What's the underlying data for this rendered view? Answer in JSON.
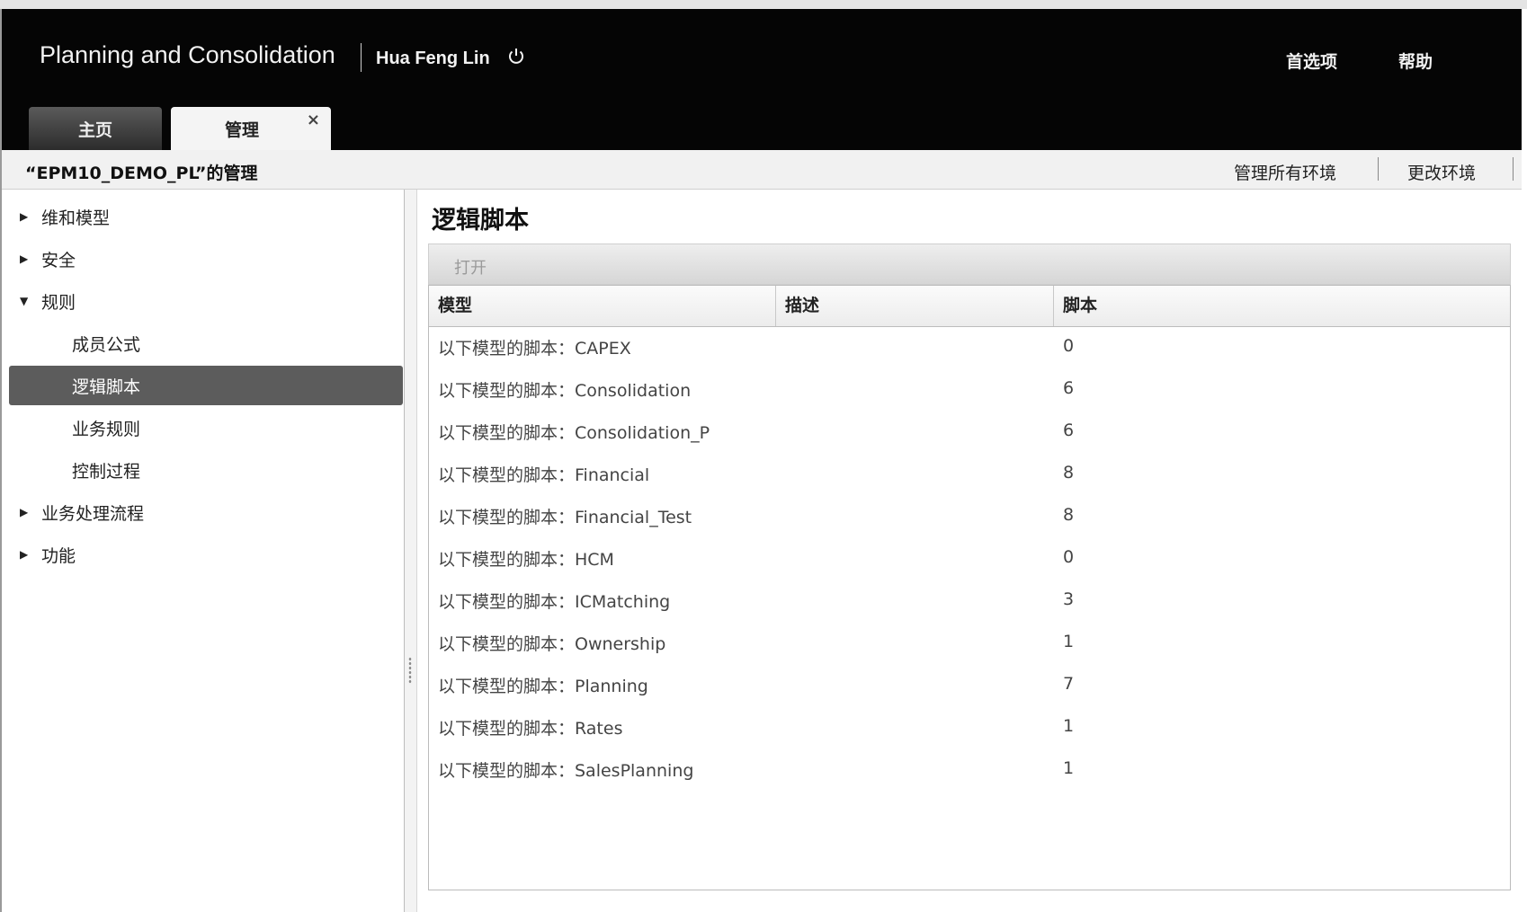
{
  "header": {
    "app_title": "Planning and Consolidation",
    "user_name": "Hua Feng Lin",
    "preferences_label": "首选项",
    "help_label": "帮助"
  },
  "tabs": [
    {
      "label": "主页"
    },
    {
      "label": "管理",
      "close": "×"
    }
  ],
  "breadcrumb": {
    "title": "“EPM10_DEMO_PL”的管理",
    "manage_all_label": "管理所有环境",
    "change_env_label": "更改环境"
  },
  "sidebar": {
    "items": [
      {
        "label": "维和模型",
        "arrow": "▶"
      },
      {
        "label": "安全",
        "arrow": "▶"
      },
      {
        "label": "规则",
        "arrow": "▼"
      },
      {
        "label": "成员公式"
      },
      {
        "label": "逻辑脚本"
      },
      {
        "label": "业务规则"
      },
      {
        "label": "控制过程"
      },
      {
        "label": "业务处理流程",
        "arrow": "▶"
      },
      {
        "label": "功能",
        "arrow": "▶"
      }
    ]
  },
  "main": {
    "title": "逻辑脚本",
    "open_label": "打开",
    "columns": [
      "模型",
      "描述",
      "脚本"
    ],
    "rows": [
      {
        "model": "以下模型的脚本：CAPEX",
        "desc": "",
        "scripts": "0"
      },
      {
        "model": "以下模型的脚本：Consolidation",
        "desc": "",
        "scripts": "6"
      },
      {
        "model": "以下模型的脚本：Consolidation_P",
        "desc": "",
        "scripts": "6"
      },
      {
        "model": "以下模型的脚本：Financial",
        "desc": "",
        "scripts": "8"
      },
      {
        "model": "以下模型的脚本：Financial_Test",
        "desc": "",
        "scripts": "8"
      },
      {
        "model": "以下模型的脚本：HCM",
        "desc": "",
        "scripts": "0"
      },
      {
        "model": "以下模型的脚本：ICMatching",
        "desc": "",
        "scripts": "3"
      },
      {
        "model": "以下模型的脚本：Ownership",
        "desc": "",
        "scripts": "1"
      },
      {
        "model": "以下模型的脚本：Planning",
        "desc": "",
        "scripts": "7"
      },
      {
        "model": "以下模型的脚本：Rates",
        "desc": "",
        "scripts": "1"
      },
      {
        "model": "以下模型的脚本：SalesPlanning",
        "desc": "",
        "scripts": "1"
      }
    ]
  }
}
